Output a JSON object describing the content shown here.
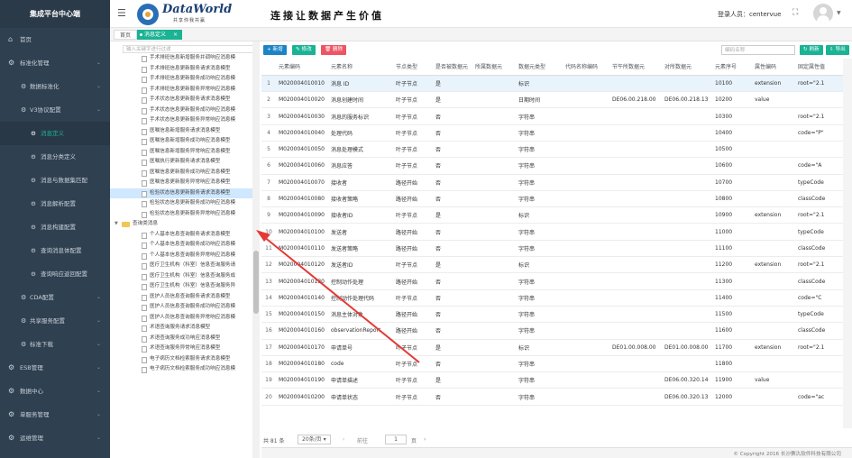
{
  "app": {
    "title": "集成平台中心端"
  },
  "header": {
    "logo_text": "DataWorld",
    "logo_sub": "共享你我共赢",
    "slogan": "连接让数据产生价值",
    "login_label": "登录人员：centervue"
  },
  "sidebar": {
    "items": [
      {
        "label": "首页",
        "icon": "home-icon"
      },
      {
        "label": "标准化管理",
        "icon": "gear-icon"
      }
    ],
    "sub_items": [
      {
        "label": "数据标准化"
      },
      {
        "label": "V3协议配置"
      }
    ],
    "leaves": [
      {
        "label": "消息定义",
        "active": true
      },
      {
        "label": "消息分类定义"
      },
      {
        "label": "消息与数据集匹配"
      },
      {
        "label": "消息解析配置"
      },
      {
        "label": "消息构建配置"
      },
      {
        "label": "查询消息体配置"
      },
      {
        "label": "查询响应返回配置"
      }
    ],
    "sub_items_2": [
      {
        "label": "CDA配置"
      },
      {
        "label": "共享服务配置"
      },
      {
        "label": "标准下载"
      }
    ],
    "items_2": [
      {
        "label": "ESB管理"
      },
      {
        "label": "数据中心"
      },
      {
        "label": "单服务管理"
      },
      {
        "label": "运维管理"
      },
      {
        "label": "其它管理"
      }
    ]
  },
  "tabs": {
    "home": "首页",
    "active": "消息定义"
  },
  "tree": {
    "search_placeholder": "输入关键字进行过滤",
    "nodes_top": [
      "手术排班信息新增服务并调响应消息模",
      "手术排班信息更新服务请求消息模型",
      "手术排班信息更新服务成功响应消息模",
      "手术排班信息更新服务异常响应消息模",
      "手术状态信息更新服务请求消息模型",
      "手术状态信息更新服务成功响应消息模",
      "手术状态信息更新服务异常响应消息模",
      "医嘱信息新增服务请求消息模型",
      "医嘱信息新增服务成功响应消息模型",
      "医嘱信息新增服务异常响应消息模型",
      "医嘱执行更新服务请求消息模型",
      "医嘱信息更新服务成功响应消息模型",
      "医嘱信息更新服务异常响应消息模型",
      "检验状态信息更新服务请求消息模型",
      "检验状态信息更新服务成功响应消息模",
      "检验状态信息更新服务异常响应消息模"
    ],
    "highlight_index": 13,
    "folder": "查询类消息",
    "nodes_bottom": [
      "个人基本信息查询服务请求消息模型",
      "个人基本信息查询服务成功响应消息模",
      "个人基本信息查询服务异常响应消息模",
      "医疗卫生机构（科室）信息查询服务请",
      "医疗卫生机构（科室）信息查询服务成",
      "医疗卫生机构（科室）信息查询服务异",
      "医护人员信息查询服务请求消息模型",
      "医护人员信息查询服务成功响应消息模",
      "医护人员信息查询服务异常响应消息模",
      "术语查询服务请求消息模型",
      "术语查询服务成功响应消息模型",
      "术语查询服务异常响应消息模型",
      "电子病历文档检索服务请求消息模型",
      "电子病历文档检索服务成功响应消息模"
    ]
  },
  "toolbar": {
    "add": "新增",
    "edit": "修改",
    "delete": "删除",
    "search_placeholder": "编码名称",
    "refresh": "刷新",
    "export": "导出"
  },
  "table": {
    "columns": [
      "",
      "元素编码",
      "元素名称",
      "节点类型",
      "是否被数据元",
      "所属数据元",
      "数据元类型",
      "代码名称编码",
      "节午所数据元",
      "对所数据元",
      "元素序号",
      "属性编码",
      "固定属性值"
    ],
    "rows": [
      [
        "1",
        "M020004010010",
        "消息 ID",
        "叶子节点",
        "是",
        "",
        "标识",
        "",
        "",
        "",
        "10100",
        "extension",
        "root=\"2.1"
      ],
      [
        "2",
        "M020004010020",
        "消息创建时间",
        "叶子节点",
        "是",
        "",
        "日期时间",
        "",
        "DE06.00.218.00",
        "DE06.00.218.13",
        "10200",
        "value",
        ""
      ],
      [
        "3",
        "M020004010030",
        "消息的服务标识",
        "叶子节点",
        "否",
        "",
        "字符串",
        "",
        "",
        "",
        "10300",
        "",
        "root=\"2.1"
      ],
      [
        "4",
        "M020004010040",
        "处理代码",
        "叶子节点",
        "否",
        "",
        "字符串",
        "",
        "",
        "",
        "10400",
        "",
        "code=\"P\""
      ],
      [
        "5",
        "M020004010050",
        "消息处理模式",
        "叶子节点",
        "否",
        "",
        "字符串",
        "",
        "",
        "",
        "10500",
        "",
        ""
      ],
      [
        "6",
        "M020004010060",
        "消息应答",
        "叶子节点",
        "否",
        "",
        "字符串",
        "",
        "",
        "",
        "10600",
        "",
        "code=\"A"
      ],
      [
        "7",
        "M020004010070",
        "接收者",
        "路径开始",
        "否",
        "",
        "字符串",
        "",
        "",
        "",
        "10700",
        "",
        "typeCode"
      ],
      [
        "8",
        "M020004010080",
        "接收者策略",
        "路径开始",
        "否",
        "",
        "字符串",
        "",
        "",
        "",
        "10800",
        "",
        "classCode"
      ],
      [
        "9",
        "M020004010090",
        "接收者ID",
        "叶子节点",
        "是",
        "",
        "标识",
        "",
        "",
        "",
        "10900",
        "extension",
        "root=\"2.1"
      ],
      [
        "10",
        "M020004010100",
        "发送者",
        "路径开始",
        "否",
        "",
        "字符串",
        "",
        "",
        "",
        "11000",
        "",
        "typeCode"
      ],
      [
        "11",
        "M020004010110",
        "发送者策略",
        "路径开始",
        "否",
        "",
        "字符串",
        "",
        "",
        "",
        "11100",
        "",
        "classCode"
      ],
      [
        "12",
        "M020004010120",
        "发送者ID",
        "叶子节点",
        "是",
        "",
        "标识",
        "",
        "",
        "",
        "11200",
        "extension",
        "root=\"2.1"
      ],
      [
        "13",
        "M020004010130",
        "控制动作处理",
        "路径开始",
        "否",
        "",
        "字符串",
        "",
        "",
        "",
        "11300",
        "",
        "classCode"
      ],
      [
        "14",
        "M020004010140",
        "控制动作处理代码",
        "叶子节点",
        "否",
        "",
        "字符串",
        "",
        "",
        "",
        "11400",
        "",
        "code=\"C"
      ],
      [
        "15",
        "M020004010150",
        "消息主体对象",
        "路径开始",
        "否",
        "",
        "字符串",
        "",
        "",
        "",
        "11500",
        "",
        "typeCode"
      ],
      [
        "16",
        "M020004010160",
        "observationReport",
        "路径开始",
        "否",
        "",
        "字符串",
        "",
        "",
        "",
        "11600",
        "",
        "classCode"
      ],
      [
        "17",
        "M020004010170",
        "申请单号",
        "叶子节点",
        "是",
        "",
        "标识",
        "",
        "DE01.00.008.00",
        "DE01.00.008.00",
        "11700",
        "extension",
        "root=\"2.1"
      ],
      [
        "18",
        "M020004010180",
        "code",
        "叶子节点",
        "否",
        "",
        "字符串",
        "",
        "",
        "",
        "11800",
        "",
        ""
      ],
      [
        "19",
        "M020004010190",
        "申请单描述",
        "叶子节点",
        "是",
        "",
        "字符串",
        "",
        "",
        "DE06.00.320.14",
        "11900",
        "value",
        ""
      ],
      [
        "20",
        "M020004010200",
        "申请单状态",
        "叶子节点",
        "否",
        "",
        "字符串",
        "",
        "",
        "DE06.00.320.13",
        "12000",
        "",
        "code=\"ac"
      ]
    ],
    "selected_row": 0
  },
  "pager": {
    "total": "共 81 条",
    "page_size": "20条/页",
    "prev": "前往",
    "current": "1",
    "page_unit": "页"
  },
  "footer": {
    "copyright": "© Copyright 2016 长沙赛氿软件科技有限公司"
  },
  "colors": {
    "sidebar": "#2f4050",
    "accent": "#1ab394",
    "primary": "#1c84c6",
    "danger": "#ed5565",
    "annotation_arrow": "#e53935"
  }
}
